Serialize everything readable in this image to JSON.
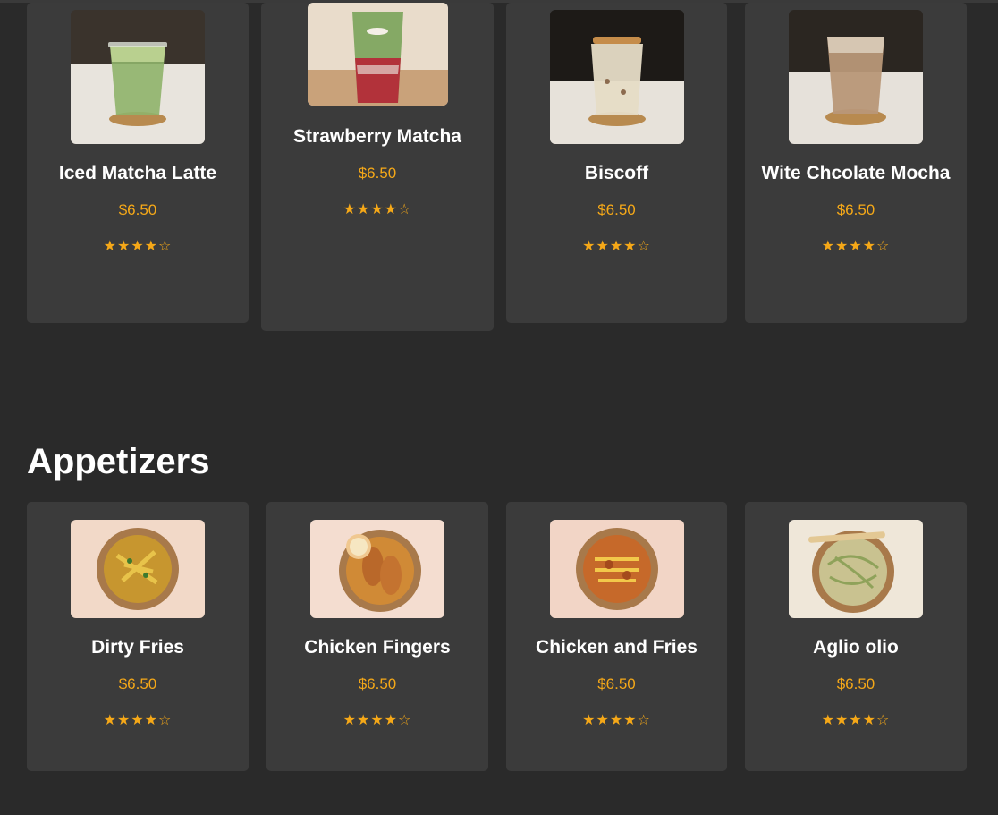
{
  "drinks": [
    {
      "name": "Iced Matcha Latte",
      "price": "$6.50",
      "stars": "★★★★☆",
      "rating": 4
    },
    {
      "name": "Strawberry Matcha",
      "price": "$6.50",
      "stars": "★★★★☆",
      "rating": 4
    },
    {
      "name": "Biscoff",
      "price": "$6.50",
      "stars": "★★★★☆",
      "rating": 4
    },
    {
      "name": "Wite Chcolate Mocha",
      "price": "$6.50",
      "stars": "★★★★☆",
      "rating": 4
    }
  ],
  "appetizers": {
    "title": "Appetizers",
    "items": [
      {
        "name": "Dirty Fries",
        "price": "$6.50",
        "stars": "★★★★☆",
        "rating": 4
      },
      {
        "name": "Chicken Fingers",
        "price": "$6.50",
        "stars": "★★★★☆",
        "rating": 4
      },
      {
        "name": "Chicken and Fries",
        "price": "$6.50",
        "stars": "★★★★☆",
        "rating": 4
      },
      {
        "name": "Aglio olio",
        "price": "$6.50",
        "stars": "★★★★☆",
        "rating": 4
      }
    ]
  },
  "colors": {
    "background": "#2a2a2a",
    "card": "#3b3b3b",
    "accent": "#f5a818",
    "text": "#ffffff"
  },
  "images": {
    "drinks": [
      "iced-matcha-latte-photo",
      "strawberry-matcha-photo",
      "biscoff-photo",
      "white-chocolate-mocha-photo"
    ],
    "appetizers": [
      "dirty-fries-photo",
      "chicken-fingers-photo",
      "chicken-and-fries-photo",
      "aglio-olio-photo"
    ]
  }
}
